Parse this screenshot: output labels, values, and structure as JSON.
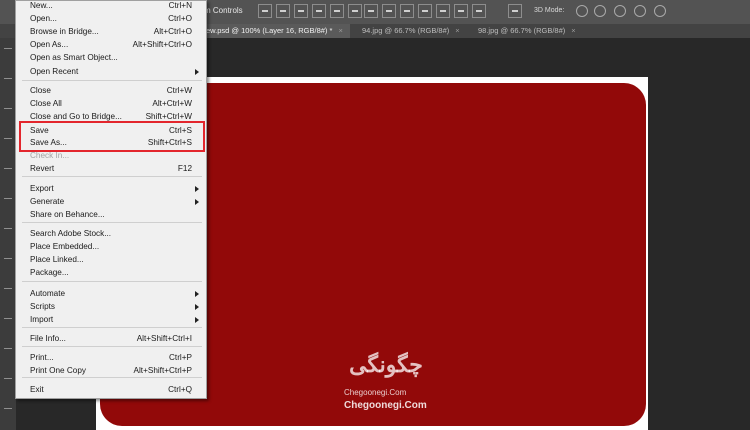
{
  "options_bar": {
    "transform_label": "m Controls",
    "mode_label": "3D Mode:"
  },
  "tabs": [
    {
      "label": "ew.psd @ 100% (Layer 16, RGB/8#) *",
      "close": "×",
      "active": true
    },
    {
      "label": "94.jpg @ 66.7% (RGB/8#)",
      "close": "×",
      "active": false
    },
    {
      "label": "98.jpg @ 66.7% (RGB/8#)",
      "close": "×",
      "active": false
    }
  ],
  "file_menu": {
    "items": [
      {
        "label": "New...",
        "shortcut": "Ctrl+N"
      },
      {
        "label": "Open...",
        "shortcut": "Ctrl+O"
      },
      {
        "label": "Browse in Bridge...",
        "shortcut": "Alt+Ctrl+O"
      },
      {
        "label": "Open As...",
        "shortcut": "Alt+Shift+Ctrl+O"
      },
      {
        "label": "Open as Smart Object...",
        "shortcut": ""
      },
      {
        "label": "Open Recent",
        "shortcut": "",
        "submenu": true
      },
      {
        "label": "Close",
        "shortcut": "Ctrl+W"
      },
      {
        "label": "Close All",
        "shortcut": "Alt+Ctrl+W"
      },
      {
        "label": "Close and Go to Bridge...",
        "shortcut": "Shift+Ctrl+W"
      },
      {
        "label": "Save",
        "shortcut": "Ctrl+S"
      },
      {
        "label": "Save As...",
        "shortcut": "Shift+Ctrl+S"
      },
      {
        "label": "Check In...",
        "shortcut": "",
        "disabled": true
      },
      {
        "label": "Revert",
        "shortcut": "F12"
      },
      {
        "label": "Export",
        "shortcut": "",
        "submenu": true
      },
      {
        "label": "Generate",
        "shortcut": "",
        "submenu": true
      },
      {
        "label": "Share on Behance...",
        "shortcut": ""
      },
      {
        "label": "Search Adobe Stock...",
        "shortcut": ""
      },
      {
        "label": "Place Embedded...",
        "shortcut": ""
      },
      {
        "label": "Place Linked...",
        "shortcut": ""
      },
      {
        "label": "Package...",
        "shortcut": ""
      },
      {
        "label": "Automate",
        "shortcut": "",
        "submenu": true
      },
      {
        "label": "Scripts",
        "shortcut": "",
        "submenu": true
      },
      {
        "label": "Import",
        "shortcut": "",
        "submenu": true
      },
      {
        "label": "File Info...",
        "shortcut": "Alt+Shift+Ctrl+I"
      },
      {
        "label": "Print...",
        "shortcut": "Ctrl+P"
      },
      {
        "label": "Print One Copy",
        "shortcut": "Alt+Shift+Ctrl+P"
      },
      {
        "label": "Exit",
        "shortcut": "Ctrl+Q"
      }
    ],
    "highlight_color": "#e3262d"
  },
  "canvas": {
    "card_color": "#920909"
  },
  "watermark": {
    "logo_text": "چگونگی",
    "sub1": "Chegoonegi.Com",
    "sub2": "Chegoonegi.Com"
  }
}
